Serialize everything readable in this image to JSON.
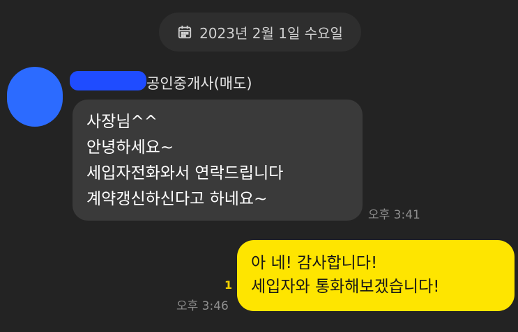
{
  "date_header": {
    "icon": "calendar-icon",
    "text": "2023년 2월 1일 수요일"
  },
  "incoming": {
    "sender": "공인중개사(매도)",
    "lines": [
      "사장님^^",
      "안녕하세요~",
      "세입자전화와서 연락드립니다",
      "계약갱신하신다고 하네요~"
    ],
    "time": "오후 3:41"
  },
  "outgoing": {
    "lines": [
      "아 네! 감사합니다!",
      "세입자와 통화해보겠습니다!"
    ],
    "unread_count": "1",
    "time": "오후 3:46"
  },
  "colors": {
    "background": "#232323",
    "incoming_bubble": "#3a3a3a",
    "outgoing_bubble": "#fee500",
    "redaction": "#1f4cff"
  }
}
